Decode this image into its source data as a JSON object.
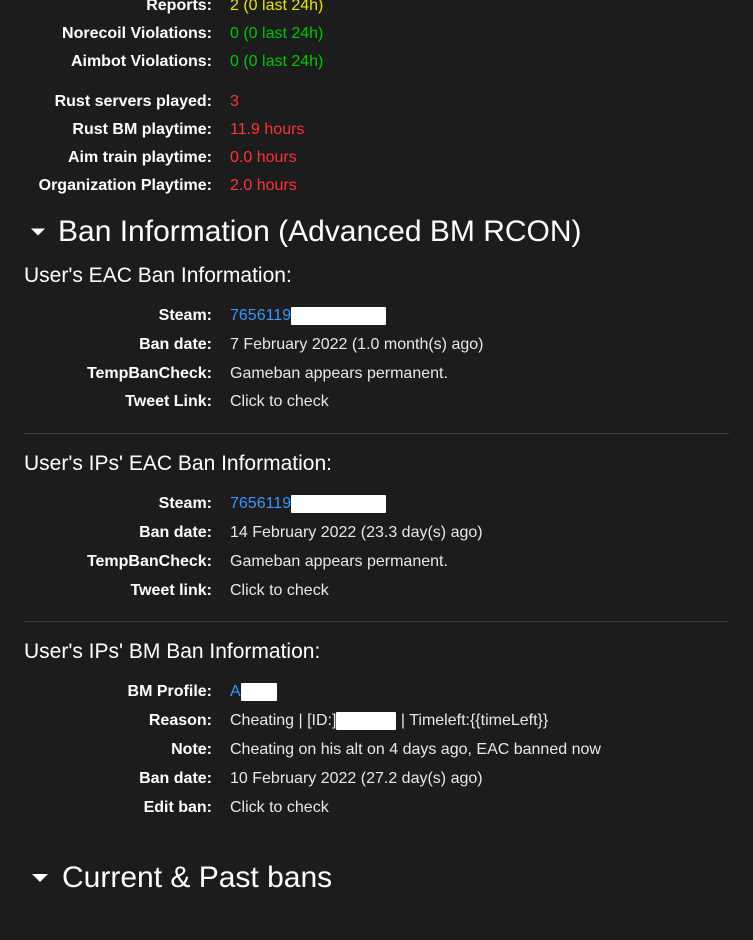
{
  "stats": {
    "reports": {
      "label": "Reports:",
      "value": "2 (0 last 24h)"
    },
    "norecoil": {
      "label": "Norecoil Violations:",
      "value": "0 (0 last 24h)"
    },
    "aimbot": {
      "label": "Aimbot Violations:",
      "value": "0 (0 last 24h)"
    },
    "rust_servers": {
      "label": "Rust servers played:",
      "value": "3"
    },
    "rust_bm_playtime": {
      "label": "Rust BM playtime:",
      "value": "11.9 hours"
    },
    "aim_train_playtime": {
      "label": "Aim train playtime:",
      "value": "0.0 hours"
    },
    "org_playtime": {
      "label": "Organization Playtime:",
      "value": "2.0 hours"
    }
  },
  "ban_info_header": "Ban Information (Advanced BM RCON)",
  "eac": {
    "heading": "User's EAC Ban Information:",
    "labels": {
      "steam": "Steam:",
      "ban_date": "Ban date:",
      "tempban": "TempBanCheck:",
      "tweet": "Tweet Link:"
    },
    "steam_prefix": "7656119",
    "ban_date": "7 February 2022 (1.0 month(s) ago)",
    "tempban": "Gameban appears permanent.",
    "tweet_link": "Click to check"
  },
  "ips_eac": {
    "heading": "User's IPs' EAC Ban Information:",
    "labels": {
      "steam": "Steam:",
      "ban_date": "Ban date:",
      "tempban": "TempBanCheck:",
      "tweet": "Tweet link:"
    },
    "steam_prefix": "7656119",
    "ban_date": "14 February 2022 (23.3 day(s) ago)",
    "tempban": "Gameban appears permanent.",
    "tweet_link": "Click to check"
  },
  "ips_bm": {
    "heading": "User's IPs' BM Ban Information:",
    "labels": {
      "bm_profile": "BM Profile:",
      "reason": "Reason:",
      "note": "Note:",
      "ban_date": "Ban date:",
      "edit_ban": "Edit ban:"
    },
    "bm_profile_prefix": "A",
    "reason_prefix": "Cheating | [ID:]",
    "reason_suffix": "| Timeleft:{{timeLeft}}",
    "note": "Cheating on his alt on 4 days ago, EAC banned now",
    "ban_date": "10 February 2022 (27.2 day(s) ago)",
    "edit_link": "Click to check"
  },
  "past_bans_header": "Current & Past bans"
}
